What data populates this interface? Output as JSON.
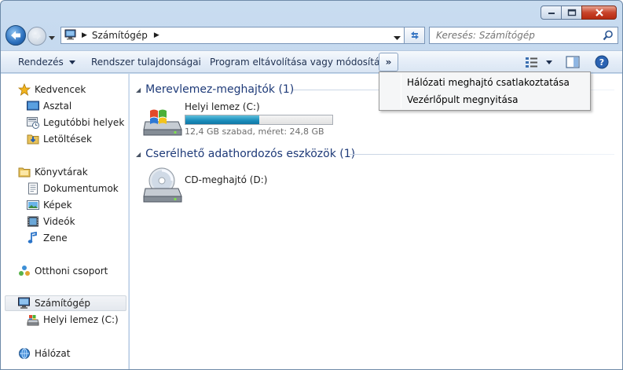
{
  "titlebar": {
    "minimize_icon": "minimize-icon",
    "maximize_icon": "maximize-icon",
    "close_icon": "close-icon"
  },
  "address": {
    "breadcrumb": "Számítógép",
    "search_placeholder": "Keresés: Számítógép"
  },
  "toolbar": {
    "organize": "Rendezés",
    "system_properties": "Rendszer tulajdonságai",
    "uninstall": "Program eltávolítása vagy módosítása",
    "more": "»"
  },
  "overflow_menu": {
    "items": [
      {
        "label": "Hálózati meghajtó csatlakoztatása"
      },
      {
        "label": "Vezérlőpult megnyitása"
      }
    ]
  },
  "sidebar": {
    "favorites": {
      "label": "Kedvencek",
      "items": [
        {
          "label": "Asztal",
          "icon": "desktop-icon"
        },
        {
          "label": "Legutóbbi helyek",
          "icon": "recent-places-icon"
        },
        {
          "label": "Letöltések",
          "icon": "downloads-icon"
        }
      ]
    },
    "libraries": {
      "label": "Könyvtárak",
      "items": [
        {
          "label": "Dokumentumok",
          "icon": "documents-icon"
        },
        {
          "label": "Képek",
          "icon": "pictures-icon"
        },
        {
          "label": "Videók",
          "icon": "videos-icon"
        },
        {
          "label": "Zene",
          "icon": "music-icon"
        }
      ]
    },
    "homegroup": {
      "label": "Otthoni csoport"
    },
    "computer": {
      "label": "Számítógép",
      "items": [
        {
          "label": "Helyi lemez (C:)",
          "icon": "drive-icon"
        }
      ]
    },
    "network": {
      "label": "Hálózat"
    }
  },
  "content": {
    "hdd_group": "Merevlemez-meghajtók (1)",
    "removable_group": "Cserélhető adathordozós eszközök (1)",
    "local_disk": {
      "name": "Helyi lemez (C:)",
      "info": "12,4 GB szabad, méret: 24,8 GB",
      "used_fraction": 0.5
    },
    "cd_drive": {
      "name": "CD-meghajtó (D:)"
    }
  }
}
